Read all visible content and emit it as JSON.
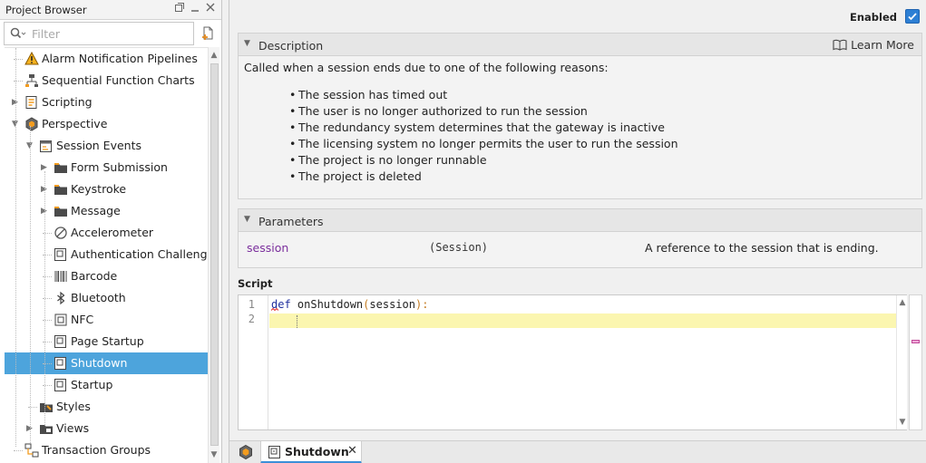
{
  "project_browser": {
    "title": "Project Browser",
    "filter_placeholder": "Filter",
    "items": [
      {
        "label": "Alarm Notification Pipelines",
        "icon": "alarm-pipeline-icon"
      },
      {
        "label": "Sequential Function Charts",
        "icon": "sfc-icon"
      },
      {
        "label": "Scripting",
        "icon": "scripting-icon"
      },
      {
        "label": "Perspective",
        "icon": "perspective-icon"
      },
      {
        "label": "Session Events",
        "icon": "session-events-icon"
      },
      {
        "label": "Form Submission",
        "icon": "folder-icon"
      },
      {
        "label": "Keystroke",
        "icon": "folder-icon"
      },
      {
        "label": "Message",
        "icon": "folder-icon"
      },
      {
        "label": "Accelerometer",
        "icon": "accelerometer-icon"
      },
      {
        "label": "Authentication Challenge",
        "icon": "script-doc-icon"
      },
      {
        "label": "Barcode",
        "icon": "barcode-icon"
      },
      {
        "label": "Bluetooth",
        "icon": "bluetooth-icon"
      },
      {
        "label": "NFC",
        "icon": "nfc-icon"
      },
      {
        "label": "Page Startup",
        "icon": "script-doc-icon"
      },
      {
        "label": "Shutdown",
        "icon": "script-doc-icon",
        "selected": true
      },
      {
        "label": "Startup",
        "icon": "script-doc-icon"
      },
      {
        "label": "Styles",
        "icon": "styles-folder-icon"
      },
      {
        "label": "Views",
        "icon": "views-folder-icon"
      },
      {
        "label": "Transaction Groups",
        "icon": "transaction-groups-icon"
      }
    ]
  },
  "main": {
    "enabled_label": "Enabled",
    "enabled": true,
    "description": {
      "title": "Description",
      "learn_more": "Learn More",
      "intro": "Called when a session ends due to one of the following reasons:",
      "reasons": [
        "The session has timed out",
        "The user is no longer authorized to run the session",
        "The redundancy system determines that the gateway is inactive",
        "The licensing system no longer permits the user to run the session",
        "The project is no longer runnable",
        "The project is deleted"
      ]
    },
    "parameters": {
      "title": "Parameters",
      "rows": [
        {
          "name": "session",
          "type": "(Session)",
          "description": "A reference to the session that is ending."
        }
      ]
    },
    "script": {
      "label": "Script",
      "line_numbers": [
        "1",
        "2"
      ],
      "keyword": "def",
      "func_name": " onShutdown",
      "open_paren": "(",
      "param": "session",
      "close": "):"
    },
    "tab": {
      "label": "Shutdown",
      "close": "✕"
    }
  },
  "colors": {
    "selection": "#4da4dc",
    "accent": "#3b8fd8",
    "param_name": "#7a2d9c",
    "keyword": "#1f2f9e",
    "current_line": "#fbf6b0"
  }
}
